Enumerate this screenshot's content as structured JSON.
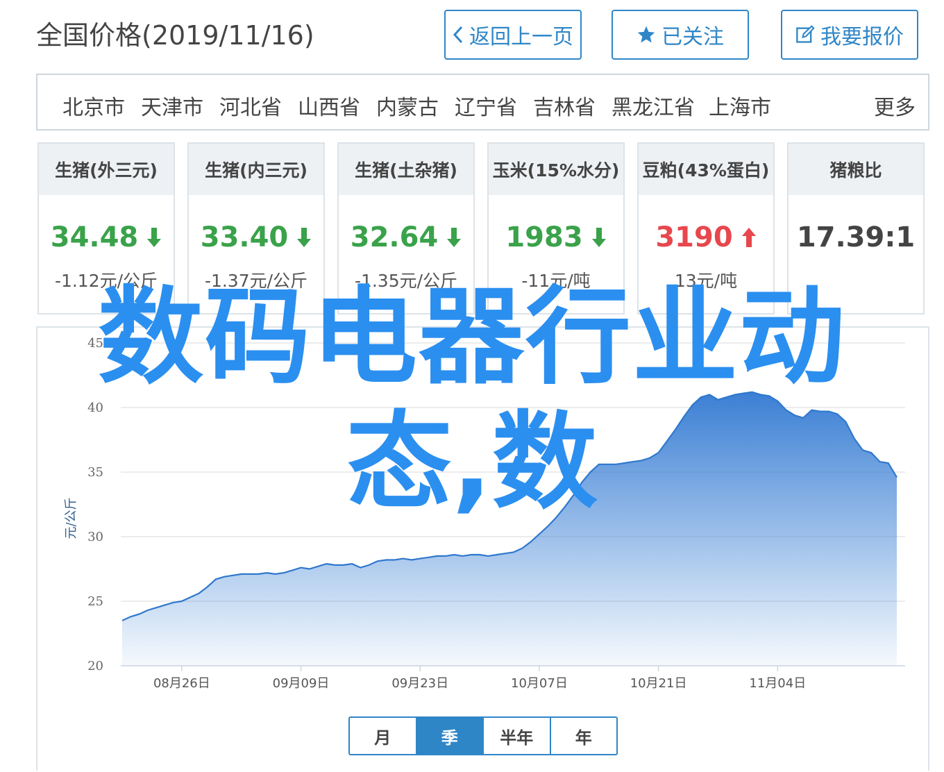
{
  "header": {
    "title": "全国价格(2019/11/16)",
    "back_label": "返回上一页",
    "follow_label": "已关注",
    "report_label": "我要报价"
  },
  "regions": [
    "北京市",
    "天津市",
    "河北省",
    "山西省",
    "内蒙古",
    "辽宁省",
    "吉林省",
    "黑龙江省",
    "上海市"
  ],
  "regions_more": "更多",
  "cards": [
    {
      "title": "生猪(外三元)",
      "value": "34.48",
      "change": "-1.12元/公斤",
      "trend": "down"
    },
    {
      "title": "生猪(内三元)",
      "value": "33.40",
      "change": "-1.37元/公斤",
      "trend": "down"
    },
    {
      "title": "生猪(土杂猪)",
      "value": "32.64",
      "change": "-1.35元/公斤",
      "trend": "down"
    },
    {
      "title": "玉米(15%水分)",
      "value": "1983",
      "change": "-11元/吨",
      "trend": "down"
    },
    {
      "title": "豆粕(43%蛋白)",
      "value": "3190",
      "change": "13元/吨",
      "trend": "up"
    },
    {
      "title": "猪粮比",
      "value": "17.39:1",
      "change": "",
      "trend": "none"
    }
  ],
  "colors": {
    "accent": "#2f86c7",
    "down": "#3aa24a",
    "up": "#e7474d",
    "area": "#3b82d6"
  },
  "periods": [
    "月",
    "季",
    "半年",
    "年"
  ],
  "active_period": "季",
  "overlay": {
    "line1": "数码电器行业动",
    "line2": "态,数"
  },
  "chart_data": {
    "type": "area",
    "ylabel": "元/公斤",
    "ylim": [
      20,
      45
    ],
    "yticks": [
      20,
      25,
      30,
      35,
      40,
      45
    ],
    "xtick_labels": [
      "08月26日",
      "09月09日",
      "09月23日",
      "10月07日",
      "10月21日",
      "11月04日"
    ],
    "xtick_index": [
      7,
      21,
      35,
      49,
      63,
      77
    ],
    "values": [
      23.5,
      23.8,
      24.0,
      24.3,
      24.5,
      24.7,
      24.9,
      25.0,
      25.3,
      25.6,
      26.1,
      26.7,
      26.9,
      27.0,
      27.1,
      27.1,
      27.1,
      27.2,
      27.1,
      27.2,
      27.4,
      27.6,
      27.5,
      27.7,
      27.9,
      27.8,
      27.8,
      27.9,
      27.6,
      27.8,
      28.1,
      28.2,
      28.2,
      28.3,
      28.2,
      28.3,
      28.4,
      28.5,
      28.5,
      28.6,
      28.5,
      28.6,
      28.6,
      28.5,
      28.6,
      28.7,
      28.8,
      29.1,
      29.6,
      30.2,
      30.8,
      31.5,
      32.3,
      33.2,
      34.2,
      35.0,
      35.6,
      35.6,
      35.6,
      35.7,
      35.8,
      35.9,
      36.1,
      36.5,
      37.4,
      38.3,
      39.3,
      40.2,
      40.8,
      41.0,
      40.6,
      40.8,
      41.0,
      41.1,
      41.2,
      41.0,
      40.9,
      40.5,
      39.8,
      39.4,
      39.2,
      39.8,
      39.7,
      39.7,
      39.5,
      38.9,
      37.6,
      36.7,
      36.5,
      35.8,
      35.7,
      34.6
    ]
  }
}
